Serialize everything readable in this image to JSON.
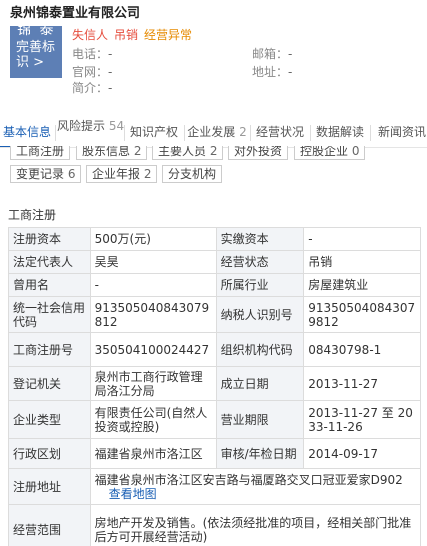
{
  "company": {
    "name": "泉州锦泰置业有限公司",
    "logo_text_top": "锦 泰",
    "logo_claim": "完善标识 >"
  },
  "status_tags": [
    {
      "label": "失信人",
      "color": "#e64d3d"
    },
    {
      "label": "吊销",
      "color": "#e64d3d"
    },
    {
      "label": "经营异常",
      "color": "#e68a00"
    }
  ],
  "contact": {
    "phone_label": "电话：",
    "phone": "-",
    "email_label": "邮箱：",
    "email": "-",
    "website_label": "官网：",
    "website": "-",
    "address_label": "地址：",
    "address": "-",
    "intro_label": "简介：",
    "intro": "-"
  },
  "tabs": [
    {
      "label": "基本信息",
      "count": ""
    },
    {
      "label": "风险提示",
      "count": "54"
    },
    {
      "label": "知识产权",
      "count": ""
    },
    {
      "label": "企业发展",
      "count": "2"
    },
    {
      "label": "经营状况",
      "count": ""
    },
    {
      "label": "数据解读",
      "count": ""
    },
    {
      "label": "新闻资讯",
      "count": ""
    }
  ],
  "chips": [
    {
      "label": "工商注册",
      "count": ""
    },
    {
      "label": "股东信息",
      "count": "2"
    },
    {
      "label": "主要人员",
      "count": "2"
    },
    {
      "label": "对外投资",
      "count": ""
    },
    {
      "label": "控股企业",
      "count": "0"
    },
    {
      "label": "变更记录",
      "count": "6"
    },
    {
      "label": "企业年报",
      "count": "2"
    },
    {
      "label": "分支机构",
      "count": ""
    }
  ],
  "section_title": "工商注册",
  "map_link": "查看地图",
  "registration": [
    {
      "k1": "注册资本",
      "v1": "500万(元)",
      "k2": "实缴资本",
      "v2": "-"
    },
    {
      "k1": "法定代表人",
      "v1": "吴昊",
      "k2": "经营状态",
      "v2": "吊销"
    },
    {
      "k1": "曾用名",
      "v1": "-",
      "k2": "所属行业",
      "v2": "房屋建筑业"
    },
    {
      "k1": "统一社会信用代码",
      "v1": "913505040843079812",
      "k2": "纳税人识别号",
      "v2": "913505040843079812"
    },
    {
      "k1": "工商注册号",
      "v1": "350504100024427",
      "k2": "组织机构代码",
      "v2": "08430798-1"
    },
    {
      "k1": "登记机关",
      "v1": "泉州市工商行政管理局洛江分局",
      "k2": "成立日期",
      "v2": "2013-11-27"
    },
    {
      "k1": "企业类型",
      "v1": "有限责任公司(自然人投资或控股)",
      "k2": "营业期限",
      "v2": "2013-11-27 至 2033-11-26"
    },
    {
      "k1": "行政区划",
      "v1": "福建省泉州市洛江区",
      "k2": "审核/年检日期",
      "v2": "2014-09-17"
    }
  ],
  "address_row": {
    "k": "注册地址",
    "v": "福建省泉州市洛江区安吉路与福厦路交叉口冠亚爱家D902"
  },
  "scope_row": {
    "k": "经营范围",
    "v": "房地产开发及销售。(依法须经批准的项目，经相关部门批准后方可开展经营活动)"
  }
}
